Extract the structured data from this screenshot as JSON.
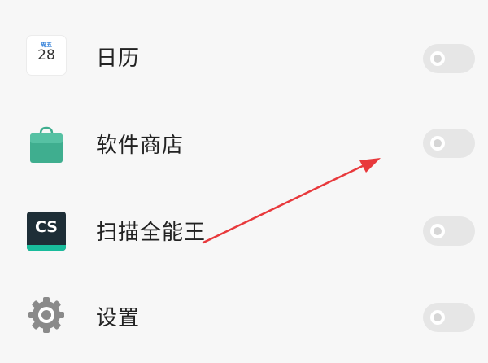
{
  "apps": [
    {
      "label": "日历",
      "icon": "calendar-icon",
      "icon_day": "周五",
      "icon_date": "28",
      "enabled": false
    },
    {
      "label": "软件商店",
      "icon": "app-store-icon",
      "enabled": false
    },
    {
      "label": "扫描全能王",
      "icon": "camscanner-icon",
      "icon_text": "CS",
      "enabled": false
    },
    {
      "label": "设置",
      "icon": "settings-gear-icon",
      "enabled": false
    }
  ],
  "colors": {
    "background": "#f7f7f7",
    "toggle_off": "#e6e6e6",
    "store_green": "#3fae8f",
    "camscanner_dark": "#1e2e37",
    "camscanner_accent": "#19bc9c",
    "annotation_arrow": "#e8393c"
  }
}
